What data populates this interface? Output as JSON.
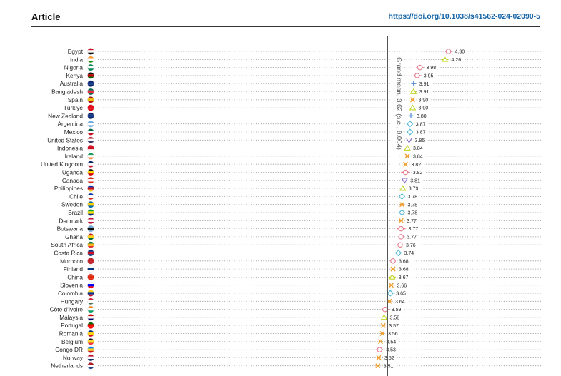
{
  "header": {
    "title": "Article",
    "doi": "https://doi.org/10.1038/s41562-024-02090-5"
  },
  "chart_data": {
    "type": "scatter",
    "grand_mean": {
      "value": 3.62,
      "label": "Grand mean, 3.62 (s.e., 0.004)"
    },
    "xlim": [
      3.5,
      4.35
    ],
    "grid": "dotted row guides",
    "colors": {
      "circle": "#e87b8c",
      "triangle": "#c2d62b",
      "cross": "#f0a030",
      "plus": "#5b8fd6",
      "diamond": "#52b7d3",
      "inverted_triangle": "#8a6bc9"
    },
    "countries": [
      {
        "name": "Egypt",
        "value": 4.3,
        "label": "4.30",
        "marker": "circle",
        "ci": 0.04
      },
      {
        "name": "India",
        "value": 4.26,
        "label": "4.26",
        "marker": "triangle",
        "ci": 0.04
      },
      {
        "name": "Nigeria",
        "value": 3.98,
        "label": "3.98",
        "marker": "circle",
        "ci": 0.04
      },
      {
        "name": "Kenya",
        "value": 3.95,
        "label": "3.95",
        "marker": "circle",
        "ci": 0.04
      },
      {
        "name": "Australia",
        "value": 3.91,
        "label": "3.91",
        "marker": "plus",
        "ci": 0.02
      },
      {
        "name": "Bangladesh",
        "value": 3.91,
        "label": "3.91",
        "marker": "triangle",
        "ci": 0.03
      },
      {
        "name": "Spain",
        "value": 3.9,
        "label": "3.90",
        "marker": "cross",
        "ci": 0.02
      },
      {
        "name": "Türkiye",
        "value": 3.9,
        "label": "3.90",
        "marker": "triangle",
        "ci": 0.02
      },
      {
        "name": "New Zealand",
        "value": 3.88,
        "label": "3.88",
        "marker": "plus",
        "ci": 0.02
      },
      {
        "name": "Argentina",
        "value": 3.87,
        "label": "3.87",
        "marker": "diamond",
        "ci": 0.03
      },
      {
        "name": "Mexico",
        "value": 3.87,
        "label": "3.87",
        "marker": "diamond",
        "ci": 0.02
      },
      {
        "name": "United States",
        "value": 3.86,
        "label": "3.86",
        "marker": "inverted_triangle",
        "ci": 0.02
      },
      {
        "name": "Indonesia",
        "value": 3.84,
        "label": "3.84",
        "marker": "triangle",
        "ci": 0.02
      },
      {
        "name": "Ireland",
        "value": 3.84,
        "label": "3.84",
        "marker": "cross",
        "ci": 0.02
      },
      {
        "name": "United Kingdom",
        "value": 3.82,
        "label": "3.82",
        "marker": "cross",
        "ci": 0.01
      },
      {
        "name": "Uganda",
        "value": 3.82,
        "label": "3.82",
        "marker": "circle",
        "ci": 0.05
      },
      {
        "name": "Canada",
        "value": 3.81,
        "label": "3.81",
        "marker": "inverted_triangle",
        "ci": 0.02
      },
      {
        "name": "Philippines",
        "value": 3.79,
        "label": "3.79",
        "marker": "triangle",
        "ci": 0.02
      },
      {
        "name": "Chile",
        "value": 3.78,
        "label": "3.78",
        "marker": "diamond",
        "ci": 0.02
      },
      {
        "name": "Sweden",
        "value": 3.78,
        "label": "3.78",
        "marker": "cross",
        "ci": 0.02
      },
      {
        "name": "Brazil",
        "value": 3.78,
        "label": "3.78",
        "marker": "diamond",
        "ci": 0.02
      },
      {
        "name": "Denmark",
        "value": 3.77,
        "label": "3.77",
        "marker": "cross",
        "ci": 0.02
      },
      {
        "name": "Botswana",
        "value": 3.77,
        "label": "3.77",
        "marker": "circle",
        "ci": 0.05
      },
      {
        "name": "Ghana",
        "value": 3.77,
        "label": "3.77",
        "marker": "circle",
        "ci": 0.03
      },
      {
        "name": "South Africa",
        "value": 3.76,
        "label": "3.76",
        "marker": "circle",
        "ci": 0.02
      },
      {
        "name": "Costa Rica",
        "value": 3.74,
        "label": "3.74",
        "marker": "diamond",
        "ci": 0.02
      },
      {
        "name": "Morocco",
        "value": 3.68,
        "label": "3.68",
        "marker": "circle",
        "ci": 0.03
      },
      {
        "name": "Finland",
        "value": 3.68,
        "label": "3.68",
        "marker": "cross",
        "ci": 0.02
      },
      {
        "name": "China",
        "value": 3.67,
        "label": "3.67",
        "marker": "triangle",
        "ci": 0.04
      },
      {
        "name": "Slovenia",
        "value": 3.66,
        "label": "3.66",
        "marker": "cross",
        "ci": 0.02
      },
      {
        "name": "Colombia",
        "value": 3.65,
        "label": "3.65",
        "marker": "diamond",
        "ci": 0.02
      },
      {
        "name": "Hungary",
        "value": 3.64,
        "label": "3.64",
        "marker": "cross",
        "ci": 0.02
      },
      {
        "name": "Côte d'Ivoire",
        "value": 3.59,
        "label": "3.59",
        "marker": "circle",
        "ci": 0.04
      },
      {
        "name": "Malaysia",
        "value": 3.58,
        "label": "3.58",
        "marker": "triangle",
        "ci": 0.02
      },
      {
        "name": "Portugal",
        "value": 3.57,
        "label": "3.57",
        "marker": "cross",
        "ci": 0.02
      },
      {
        "name": "Romania",
        "value": 3.56,
        "label": "3.56",
        "marker": "cross",
        "ci": 0.02
      },
      {
        "name": "Belgium",
        "value": 3.54,
        "label": "3.54",
        "marker": "cross",
        "ci": 0.02
      },
      {
        "name": "Congo DR",
        "value": 3.53,
        "label": "3.53",
        "marker": "circle",
        "ci": 0.04
      },
      {
        "name": "Norway",
        "value": 3.52,
        "label": "3.52",
        "marker": "cross",
        "ci": 0.02
      },
      {
        "name": "Netherlands",
        "value": 3.51,
        "label": "3.51",
        "marker": "cross",
        "ci": 0.02
      }
    ],
    "flags": [
      [
        "#ce1126",
        "#ffffff",
        "#111111"
      ],
      [
        "#ff9933",
        "#ffffff",
        "#138808"
      ],
      [
        "#008751",
        "#ffffff",
        "#008751"
      ],
      [
        "#111111",
        "#bb0000",
        "#006600"
      ],
      [
        "#012169",
        "#1e3a8a",
        "#012169"
      ],
      [
        "#006a4e",
        "#f42a41",
        "#006a4e"
      ],
      [
        "#aa151b",
        "#f1bf00",
        "#aa151b"
      ],
      [
        "#e30a17",
        "#e30a17",
        "#e30a17"
      ],
      [
        "#012169",
        "#1e3a8a",
        "#012169"
      ],
      [
        "#74acdf",
        "#ffffff",
        "#74acdf"
      ],
      [
        "#006847",
        "#ffffff",
        "#ce1126"
      ],
      [
        "#b22234",
        "#ffffff",
        "#3c3b6e"
      ],
      [
        "#ce1126",
        "#ce1126",
        "#ffffff"
      ],
      [
        "#169b62",
        "#ffffff",
        "#ff883e"
      ],
      [
        "#012169",
        "#ffffff",
        "#c8102e"
      ],
      [
        "#111111",
        "#fcdc04",
        "#d90000"
      ],
      [
        "#d52b1e",
        "#ffffff",
        "#d52b1e"
      ],
      [
        "#0038a8",
        "#ce1126",
        "#fcd116"
      ],
      [
        "#0039a6",
        "#ffffff",
        "#d52b1e"
      ],
      [
        "#006aa7",
        "#fecc00",
        "#006aa7"
      ],
      [
        "#009c3b",
        "#ffdf00",
        "#002776"
      ],
      [
        "#c60c30",
        "#ffffff",
        "#c60c30"
      ],
      [
        "#75aadb",
        "#111111",
        "#75aadb"
      ],
      [
        "#ce1126",
        "#fcd116",
        "#006b3f"
      ],
      [
        "#007a4d",
        "#ffb612",
        "#de3831"
      ],
      [
        "#002b7f",
        "#ce1126",
        "#002b7f"
      ],
      [
        "#c1272d",
        "#c1272d",
        "#c1272d"
      ],
      [
        "#ffffff",
        "#003580",
        "#ffffff"
      ],
      [
        "#de2910",
        "#de2910",
        "#de2910"
      ],
      [
        "#ffffff",
        "#0000ff",
        "#ff0000"
      ],
      [
        "#fcd116",
        "#003893",
        "#ce1126"
      ],
      [
        "#ce2939",
        "#ffffff",
        "#477050"
      ],
      [
        "#f77f00",
        "#ffffff",
        "#009e60"
      ],
      [
        "#cc0001",
        "#ffffff",
        "#010066"
      ],
      [
        "#006600",
        "#ff0000",
        "#ff0000"
      ],
      [
        "#002b7f",
        "#fcd116",
        "#ce1126"
      ],
      [
        "#111111",
        "#fdda24",
        "#ef3340"
      ],
      [
        "#007fff",
        "#f7d618",
        "#ce1021"
      ],
      [
        "#ba0c2f",
        "#ffffff",
        "#00205b"
      ],
      [
        "#ae1c28",
        "#ffffff",
        "#21468b"
      ]
    ]
  }
}
